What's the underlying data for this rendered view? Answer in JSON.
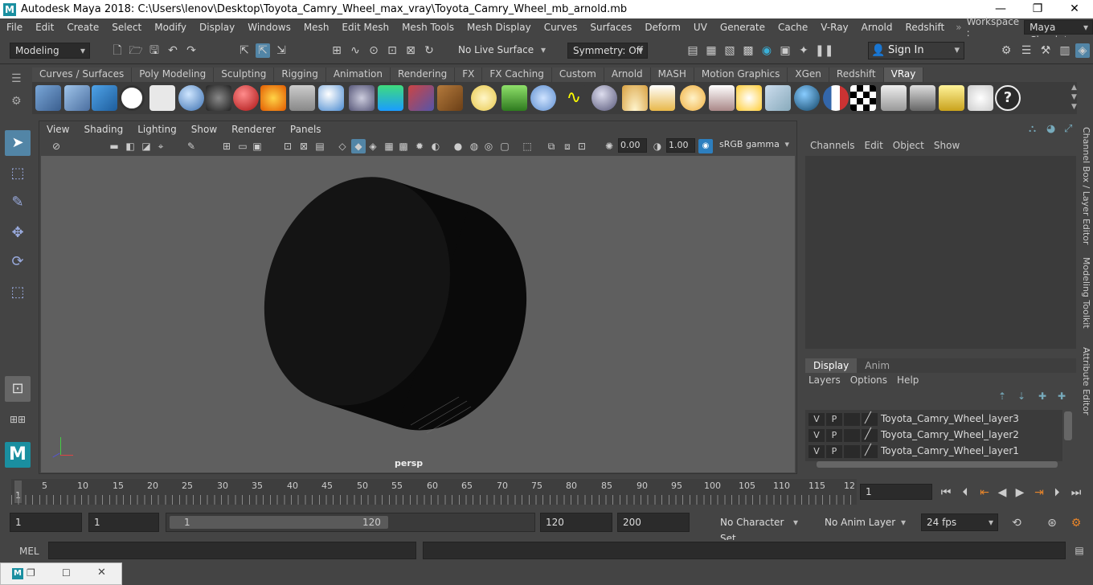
{
  "window": {
    "title": "Autodesk Maya 2018: C:\\Users\\lenov\\Desktop\\Toyota_Camry_Wheel_max_vray\\Toyota_Camry_Wheel_mb_arnold.mb",
    "minimize": "—",
    "maximize": "❐",
    "close": "✕"
  },
  "menubar": [
    "File",
    "Edit",
    "Create",
    "Select",
    "Modify",
    "Display",
    "Windows",
    "Mesh",
    "Edit Mesh",
    "Mesh Tools",
    "Mesh Display",
    "Curves",
    "Surfaces",
    "Deform",
    "UV",
    "Generate",
    "Cache",
    "V-Ray",
    "Arnold",
    "Redshift"
  ],
  "workspace": {
    "label": "Workspace :",
    "value": "Maya Classic*"
  },
  "statusline": {
    "mode": "Modeling",
    "live_surface": "No Live Surface",
    "symmetry": "Symmetry: Off",
    "sign_in": "Sign In"
  },
  "shelf_tabs": [
    "Curves / Surfaces",
    "Poly Modeling",
    "Sculpting",
    "Rigging",
    "Animation",
    "Rendering",
    "FX",
    "FX Caching",
    "Custom",
    "Arnold",
    "MASH",
    "Motion Graphics",
    "XGen",
    "Redshift",
    "VRay"
  ],
  "shelf_active": "VRay",
  "viewport": {
    "menu": [
      "View",
      "Shading",
      "Lighting",
      "Show",
      "Renderer",
      "Panels"
    ],
    "exposure": "0.00",
    "gamma": "1.00",
    "color_space": "sRGB gamma",
    "camera_label": "persp"
  },
  "channel_box": {
    "menu": [
      "Channels",
      "Edit",
      "Object",
      "Show"
    ]
  },
  "layer_editor": {
    "tabs": [
      "Display",
      "Anim"
    ],
    "active_tab": "Display",
    "menu": [
      "Layers",
      "Options",
      "Help"
    ],
    "layers": [
      {
        "v": "V",
        "p": "P",
        "name": "Toyota_Camry_Wheel_layer3"
      },
      {
        "v": "V",
        "p": "P",
        "name": "Toyota_Camry_Wheel_layer2"
      },
      {
        "v": "V",
        "p": "P",
        "name": "Toyota_Camry_Wheel_layer1"
      }
    ]
  },
  "side_tabs": [
    "Channel Box / Layer Editor",
    "Modeling Toolkit",
    "Attribute Editor"
  ],
  "timeline": {
    "ticks": [
      "1",
      "5",
      "10",
      "15",
      "20",
      "25",
      "30",
      "35",
      "40",
      "45",
      "50",
      "55",
      "60",
      "65",
      "70",
      "75",
      "80",
      "85",
      "90",
      "95",
      "100",
      "105",
      "110",
      "115",
      "12"
    ],
    "current_frame": "1"
  },
  "range": {
    "start": "1",
    "playback_start": "1",
    "slider_start": "1",
    "slider_end": "120",
    "playback_end": "120",
    "end": "200",
    "character_set": "No Character Set",
    "anim_layer": "No Anim Layer",
    "fps": "24 fps"
  },
  "cmdline": {
    "label": "MEL"
  }
}
